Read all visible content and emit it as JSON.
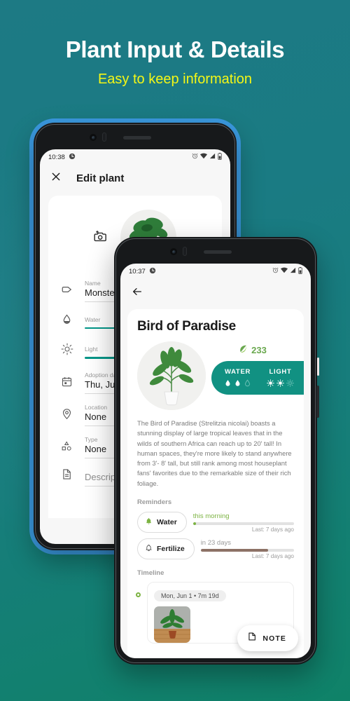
{
  "header": {
    "title": "Plant Input & Details",
    "subtitle": "Easy to keep information",
    "title_color": "#ffffff",
    "subtitle_color": "#f5f716"
  },
  "background": {
    "gradient_from": "#1d7a84",
    "gradient_to": "#0f8268"
  },
  "edit_phone": {
    "outline_color": "#3b9ae1",
    "status_bar": {
      "time": "10:38",
      "icons": [
        "clock-circle-icon",
        "alarm-icon",
        "wifi-icon",
        "signal-icon",
        "battery-icon"
      ]
    },
    "appbar": {
      "close_label": "✕",
      "title": "Edit plant"
    },
    "photo_action": {
      "icon": "add-photo-icon"
    },
    "fields": [
      {
        "icon": "tag-icon",
        "label": "Name",
        "value": "Monstera"
      },
      {
        "icon": "location-icon",
        "label": "Location",
        "value": "None"
      },
      {
        "icon": "type-icon",
        "label": "Type",
        "value": "None"
      },
      {
        "icon": "calendar-icon",
        "label": "Adoption date",
        "value": "Thu, Jun 18,"
      },
      {
        "icon": "description-icon",
        "label": "",
        "value": "Description"
      }
    ],
    "sliders": [
      {
        "icon": "water-drop-icon",
        "label": "Water",
        "color": "#009688"
      },
      {
        "icon": "sun-icon",
        "label": "Light",
        "color": "#009688"
      }
    ]
  },
  "detail_phone": {
    "status_bar": {
      "time": "10:37",
      "icons": [
        "clock-circle-icon",
        "alarm-icon",
        "wifi-icon",
        "signal-icon",
        "battery-icon"
      ]
    },
    "appbar": {
      "back_label": "←"
    },
    "title": "Bird of Paradise",
    "leaf_count": "233",
    "leaf_color": "#6aa84f",
    "care": {
      "badge_color": "#119182",
      "items": [
        {
          "label": "WATER",
          "icon": "water-drop-icon",
          "filled": 2,
          "total": 3
        },
        {
          "label": "LIGHT",
          "icon": "sun-icon",
          "filled": 2,
          "total": 3
        }
      ]
    },
    "description": "The Bird of Paradise (Strelitzia nicolai) boasts a stunning display of large tropical leaves that in the wilds of southern Africa can reach up to 20' tall! In human spaces, they're more likely to stand anywhere from 3'- 8' tall, but still rank among most houseplant fans' favorites due to the remarkable size of their rich foliage.",
    "reminders_title": "Reminders",
    "reminders": [
      {
        "label": "Water",
        "icon": "bell-filled-icon",
        "icon_color": "#7cb342",
        "when": "this morning",
        "when_color": "#7cb342",
        "progress": 3,
        "bar_color": "#7cb342",
        "last": "Last: 7 days ago"
      },
      {
        "label": "Fertilize",
        "icon": "bell-outline-icon",
        "icon_color": "#4a4a4a",
        "when": "in 23 days",
        "when_color": "#9b9b9b",
        "progress": 72,
        "bar_color": "#8d7266",
        "last": "Last: 7 days ago"
      }
    ],
    "timeline_title": "Timeline",
    "timeline": [
      {
        "chip": "Mon, Jun 1 • 7m 19d",
        "photo": "plant-photo"
      }
    ],
    "note_button": {
      "label": "NOTE",
      "icon": "note-icon"
    }
  }
}
